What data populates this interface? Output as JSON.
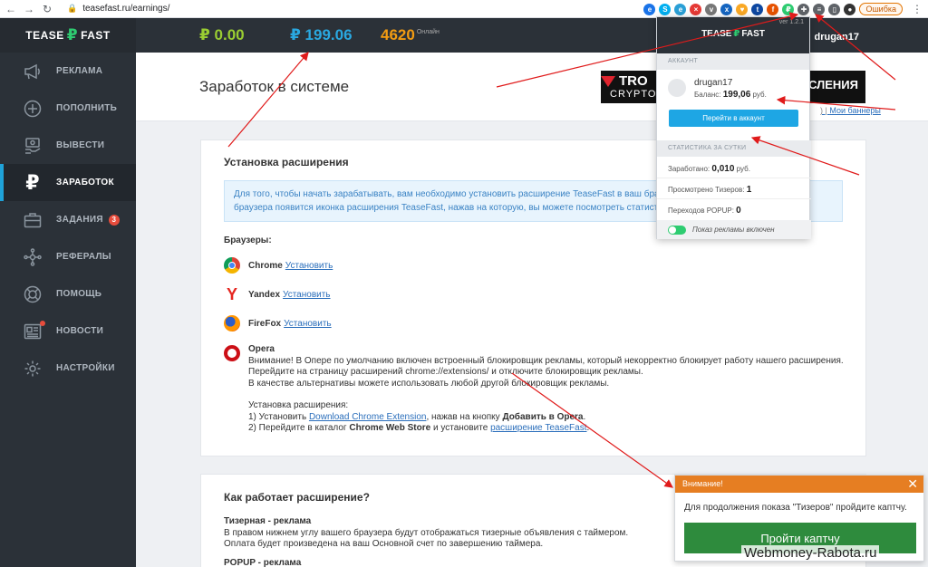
{
  "browser": {
    "url": "teasefast.ru/earnings/",
    "error_label": "Ошибка"
  },
  "brand": {
    "left": "TEASE",
    "right": "FAST"
  },
  "header": {
    "balance_main": "₽ 0.00",
    "balance_ads": "₽ 199.06",
    "online_count": "4620",
    "online_label": "Онлайн",
    "username": "drugan17"
  },
  "sidebar": {
    "items": [
      {
        "label": "РЕКЛАМА",
        "icon": "megaphone-icon"
      },
      {
        "label": "ПОПОЛНИТЬ",
        "icon": "plus-circle-icon"
      },
      {
        "label": "ВЫВЕСТИ",
        "icon": "money-withdraw-icon"
      },
      {
        "label": "ЗАРАБОТОК",
        "icon": "ruble-icon"
      },
      {
        "label": "ЗАДАНИЯ",
        "icon": "briefcase-icon",
        "badge": "3"
      },
      {
        "label": "РЕФЕРАЛЫ",
        "icon": "network-icon"
      },
      {
        "label": "ПОМОЩЬ",
        "icon": "lifebuoy-icon"
      },
      {
        "label": "НОВОСТИ",
        "icon": "newspaper-icon"
      },
      {
        "label": "НАСТРОЙКИ",
        "icon": "gear-icon"
      }
    ]
  },
  "page": {
    "title": "Заработок в системе",
    "banner_left": "TRO",
    "banner_left2": "CRYPTO I",
    "banner_right": "ИСЛЕНИЯ",
    "banner_link": "Мои баннеры",
    "banner_link_prefix": ") |"
  },
  "install": {
    "title": "Установка расширения",
    "info_line1": "Для того, чтобы начать зарабатывать, вам необходимо установить расширение TeaseFast в ваш браузер. По",
    "info_line2": "браузера появится иконка расширения TeaseFast, нажав на которую, вы можете посмотреть статистику и на",
    "browsers_label": "Браузеры:",
    "install_link": "Установить",
    "browsers": [
      "Chrome",
      "Yandex",
      "FireFox"
    ],
    "opera": {
      "name": "Opera",
      "line1": "Внимание! В Опере по умолчанию включен встроенный блокировщик рекламы, который некорректно блокирует работу нашего расширения.",
      "line2": "Перейдите на страницу расширений chrome://extensions/ и отключите блокировщик рекламы.",
      "line3": "В качестве альтернативы можете использовать любой другой блокировщик рекламы.",
      "steps_title": "Установка расширения:",
      "step1_prefix": "1) Установить",
      "step1_link": "Download Chrome Extension",
      "step1_mid": ", нажав на кнопку",
      "step1_bold": "Добавить в Opera",
      "step1_end": ".",
      "step2_prefix": "2) Перейдите в каталог",
      "step2_bold": "Chrome Web Store",
      "step2_mid": "и установите",
      "step2_link": "расширение TeaseFast",
      "step2_end": "."
    }
  },
  "how": {
    "title": "Как работает расширение?",
    "sub1": "Тизерная - реклама",
    "line1": "В правом нижнем углу вашего браузера будут отображаться тизерные объявления с таймером.",
    "line2": "Оплата будет произведена на ваш Основной счет по завершению таймера.",
    "sub2": "POPUP - реклама"
  },
  "popup": {
    "version": "ver 1.2.1",
    "brand_left": "TEASE",
    "brand_right": "FAST",
    "section_account": "АККАУНТ",
    "username": "drugan17",
    "balance_label": "Баланс:",
    "balance_value": "199,06",
    "balance_unit": "руб.",
    "go_button": "Перейти в аккаунт",
    "section_stats": "СТАТИСТИКА ЗА СУТКИ",
    "earned_label": "Заработано:",
    "earned_value": "0,010",
    "earned_unit": "руб.",
    "viewed_label": "Просмотрено Тизеров:",
    "viewed_value": "1",
    "popup_label": "Переходов POPUP:",
    "popup_value": "0",
    "ads_enabled": "Показ рекламы включен"
  },
  "notice": {
    "title": "Внимание!",
    "text": "Для продолжения показа \"Тизеров\" пройдите каптчу.",
    "button": "Пройти каптчу"
  },
  "watermark": "Webmoney-Rabota.ru"
}
